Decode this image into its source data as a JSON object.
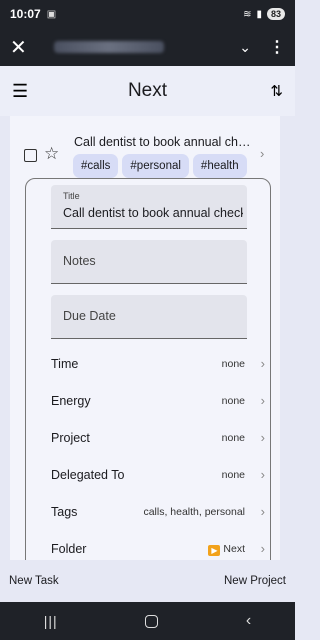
{
  "status_bar": {
    "time": "10:07",
    "battery": "83"
  },
  "app_bar": {
    "title": "Next"
  },
  "task": {
    "title": "Call dentist to book annual checkup",
    "tags": [
      "#calls",
      "#personal",
      "#health"
    ]
  },
  "detail": {
    "title_field": {
      "label": "Title",
      "value": "Call dentist to book annual checkup"
    },
    "notes_placeholder": "Notes",
    "due_date_placeholder": "Due Date",
    "properties": [
      {
        "name": "Time",
        "value": "none"
      },
      {
        "name": "Energy",
        "value": "none"
      },
      {
        "name": "Project",
        "value": "none"
      },
      {
        "name": "Delegated To",
        "value": "none"
      },
      {
        "name": "Tags",
        "value": "calls, health, personal"
      },
      {
        "name": "Folder",
        "value": "Next"
      }
    ]
  },
  "bottom_bar": {
    "new_task": "New Task",
    "new_project": "New Project"
  }
}
